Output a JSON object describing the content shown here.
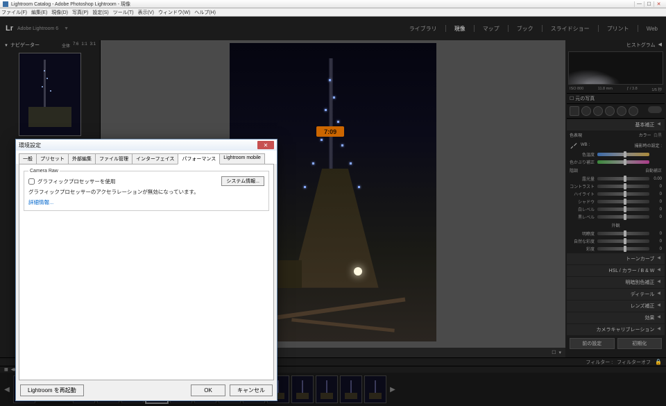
{
  "window": {
    "title": "Lightroom Catalog - Adobe Photoshop Lightroom - 現像",
    "menus": [
      "ファイル(F)",
      "編集(E)",
      "現像(D)",
      "写真(P)",
      "設定(S)",
      "ツール(T)",
      "表示(V)",
      "ウィンドウ(W)",
      "ヘルプ(H)"
    ]
  },
  "lr": {
    "logo": "Lr",
    "brand": "Adobe Lightroom 6",
    "modules": [
      "ライブラリ",
      "現像",
      "マップ",
      "ブック",
      "スライドショー",
      "プリント",
      "Web"
    ],
    "active_module": "現像"
  },
  "navigator": {
    "title": "ナビゲーター",
    "zoom": [
      "全体",
      "1:1",
      "3:1"
    ],
    "extra": "7:6"
  },
  "histogram": {
    "title": "ヒストグラム",
    "iso": "ISO 800",
    "focal": "11.8 mm",
    "aperture": "ƒ / 3.8",
    "shutter": "1/5 秒",
    "original": "元の写真"
  },
  "basic": {
    "header": "基本補正",
    "treatment_color": "カラー",
    "treatment_bw": "白黒",
    "profile_label": "色表現",
    "wb_label": "WB :",
    "wb_value": "撮影時の設定 :",
    "temp": "色温度",
    "tint": "色かぶり補正",
    "tone_header": "階調",
    "auto": "自動補正",
    "exposure": "露光量",
    "exposure_val": "0.00",
    "contrast": "コントラスト",
    "highlights": "ハイライト",
    "shadows": "シャドウ",
    "whites": "白レベル",
    "blacks": "黒レベル",
    "presence_header": "外観",
    "clarity": "明瞭度",
    "vibrance": "自然な彩度",
    "saturation": "彩度",
    "zero": "0"
  },
  "sections": [
    "トーンカーブ",
    "HSL   /   カラー   /   B & W",
    "明暗別色補正",
    "ディテール",
    "レンズ補正",
    "効果",
    "カメラキャリブレーション"
  ],
  "buttons": {
    "prev": "前の設定",
    "reset": "初期化"
  },
  "filter": {
    "label": "フィルター :",
    "off": "フィルターオフ"
  },
  "photo": {
    "clock": "7:09"
  },
  "dialog": {
    "title": "環境設定",
    "tabs": [
      "一般",
      "プリセット",
      "外部編集",
      "ファイル管理",
      "インターフェイス",
      "パフォーマンス",
      "Lightroom mobile"
    ],
    "active_tab": "パフォーマンス",
    "group": "Camera Raw",
    "use_gpu": "グラフィックプロセッサーを使用",
    "gpu_status": "グラフィックプロセッサーのアクセラレーションが無効になっています。",
    "details": "詳細情報...",
    "sysinfo": "システム情報...",
    "restart": "Lightroom を再起動",
    "ok": "OK",
    "cancel": "キャンセル"
  }
}
